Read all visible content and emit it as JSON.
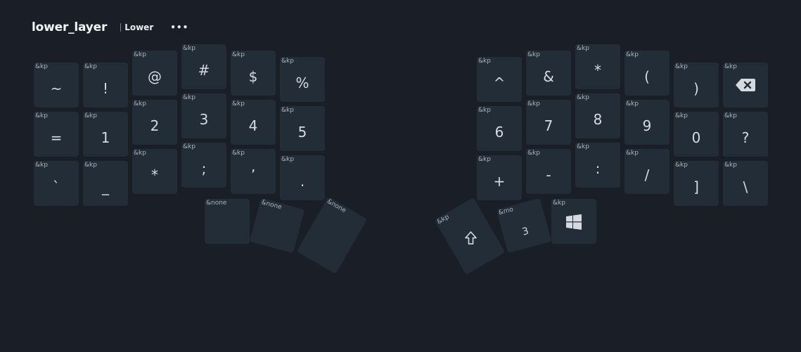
{
  "header": {
    "layer_name": "lower_layer",
    "layer_display": "Lower",
    "menu_label": "•••"
  },
  "keys": {
    "l1": {
      "binding": "&kp",
      "param": "~"
    },
    "l2": {
      "binding": "&kp",
      "param": "!"
    },
    "l3": {
      "binding": "&kp",
      "param": "@"
    },
    "l4": {
      "binding": "&kp",
      "param": "#"
    },
    "l5": {
      "binding": "&kp",
      "param": "$"
    },
    "l6": {
      "binding": "&kp",
      "param": "%"
    },
    "l7": {
      "binding": "&kp",
      "param": "="
    },
    "l8": {
      "binding": "&kp",
      "param": "1"
    },
    "l9": {
      "binding": "&kp",
      "param": "2"
    },
    "l10": {
      "binding": "&kp",
      "param": "3"
    },
    "l11": {
      "binding": "&kp",
      "param": "4"
    },
    "l12": {
      "binding": "&kp",
      "param": "5"
    },
    "l13": {
      "binding": "&kp",
      "param": "`"
    },
    "l14": {
      "binding": "&kp",
      "param": "_"
    },
    "l15": {
      "binding": "&kp",
      "param": "*"
    },
    "l16": {
      "binding": "&kp",
      "param": ";"
    },
    "l17": {
      "binding": "&kp",
      "param": "’"
    },
    "l18": {
      "binding": "&kp",
      "param": "."
    },
    "lt1": {
      "binding": "&none",
      "param": ""
    },
    "lt2": {
      "binding": "&none",
      "param": ""
    },
    "lt3": {
      "binding": "&none",
      "param": ""
    },
    "r1": {
      "binding": "&kp",
      "param": "^"
    },
    "r2": {
      "binding": "&kp",
      "param": "&"
    },
    "r3": {
      "binding": "&kp",
      "param": "*"
    },
    "r4": {
      "binding": "&kp",
      "param": "("
    },
    "r5": {
      "binding": "&kp",
      "param": ")"
    },
    "r6": {
      "binding": "&kp",
      "param": ""
    },
    "r7": {
      "binding": "&kp",
      "param": "6"
    },
    "r8": {
      "binding": "&kp",
      "param": "7"
    },
    "r9": {
      "binding": "&kp",
      "param": "8"
    },
    "r10": {
      "binding": "&kp",
      "param": "9"
    },
    "r11": {
      "binding": "&kp",
      "param": "0"
    },
    "r12": {
      "binding": "&kp",
      "param": "?"
    },
    "r13": {
      "binding": "&kp",
      "param": "+"
    },
    "r14": {
      "binding": "&kp",
      "param": "-"
    },
    "r15": {
      "binding": "&kp",
      "param": ":"
    },
    "r16": {
      "binding": "&kp",
      "param": "/"
    },
    "r17": {
      "binding": "&kp",
      "param": "]"
    },
    "r18": {
      "binding": "&kp",
      "param": "\\"
    },
    "rt1": {
      "binding": "&kp",
      "param": ""
    },
    "rt2": {
      "binding": "&mo",
      "param": "3"
    },
    "rt3": {
      "binding": "&kp",
      "param": ""
    }
  },
  "icons": {
    "r6": "backspace-icon",
    "rt1": "shift-arrow-icon",
    "rt3": "windows-logo-icon"
  }
}
